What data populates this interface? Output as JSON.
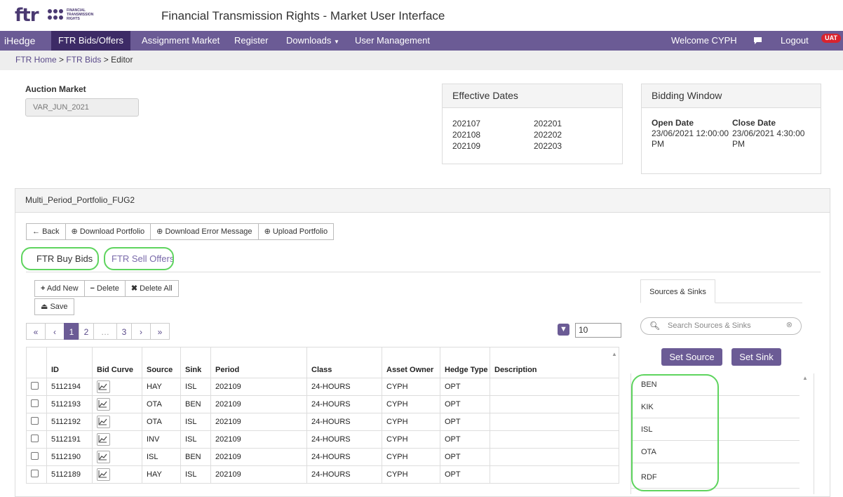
{
  "header": {
    "logo_text": "ftr",
    "logo_sub": [
      "FINANCIAL",
      "TRANSMISSION",
      "RIGHTS"
    ],
    "title": "Financial Transmission Rights - Market User Interface"
  },
  "nav": {
    "brand": "iHedge",
    "items": [
      "FTR Bids/Offers",
      "Assignment Market",
      "Register",
      "Downloads",
      "User Management"
    ],
    "welcome": "Welcome CYPH",
    "logout": "Logout",
    "env_badge": "UAT"
  },
  "breadcrumb": {
    "home": "FTR Home",
    "sep": ">",
    "bids": "FTR Bids",
    "current": "Editor"
  },
  "auction": {
    "label": "Auction Market",
    "value": "VAR_JUN_2021"
  },
  "effective_dates": {
    "title": "Effective Dates",
    "col1": [
      "202107",
      "202108",
      "202109"
    ],
    "col2": [
      "202201",
      "202202",
      "202203"
    ]
  },
  "bidding_window": {
    "title": "Bidding Window",
    "open_label": "Open Date",
    "close_label": "Close Date",
    "open_value": "23/06/2021 12:00:00 PM",
    "close_value": "23/06/2021 4:30:00 PM"
  },
  "portfolio": {
    "title": "Multi_Period_Portfolio_FUG2",
    "toolbar": {
      "back": "Back",
      "download_portfolio": "Download Portfolio",
      "download_error": "Download Error Message",
      "upload_portfolio": "Upload Portfolio"
    },
    "tabs": [
      "FTR Buy Bids",
      "FTR Sell Offers"
    ],
    "actions": {
      "add_new": "Add New",
      "delete": "Delete",
      "delete_all": "Delete All",
      "save": "Save"
    },
    "pagination": [
      "«",
      "‹",
      "1",
      "2",
      "…",
      "3",
      "›",
      "»"
    ],
    "page_size": "10",
    "columns": [
      "ID",
      "Bid Curve",
      "Source",
      "Sink",
      "Period",
      "Class",
      "Asset Owner",
      "Hedge Type",
      "Description"
    ],
    "rows": [
      {
        "id": "5112194",
        "source": "HAY",
        "sink": "ISL",
        "period": "202109",
        "class": "24-HOURS",
        "owner": "CYPH",
        "hedge": "OPT",
        "desc": ""
      },
      {
        "id": "5112193",
        "source": "OTA",
        "sink": "BEN",
        "period": "202109",
        "class": "24-HOURS",
        "owner": "CYPH",
        "hedge": "OPT",
        "desc": ""
      },
      {
        "id": "5112192",
        "source": "OTA",
        "sink": "ISL",
        "period": "202109",
        "class": "24-HOURS",
        "owner": "CYPH",
        "hedge": "OPT",
        "desc": ""
      },
      {
        "id": "5112191",
        "source": "INV",
        "sink": "ISL",
        "period": "202109",
        "class": "24-HOURS",
        "owner": "CYPH",
        "hedge": "OPT",
        "desc": ""
      },
      {
        "id": "5112190",
        "source": "ISL",
        "sink": "BEN",
        "period": "202109",
        "class": "24-HOURS",
        "owner": "CYPH",
        "hedge": "OPT",
        "desc": ""
      },
      {
        "id": "5112189",
        "source": "HAY",
        "sink": "ISL",
        "period": "202109",
        "class": "24-HOURS",
        "owner": "CYPH",
        "hedge": "OPT",
        "desc": ""
      }
    ]
  },
  "sources_sinks": {
    "tab": "Sources & Sinks",
    "search_placeholder": "Search Sources & Sinks",
    "set_source": "Set Source",
    "set_sink": "Set Sink",
    "items": [
      "BEN",
      "KIK",
      "ISL",
      "OTA",
      "RDF"
    ]
  },
  "colors": {
    "brand_purple": "#6b5b95",
    "nav_active": "#3d2b66",
    "highlight_ring": "#5ed45e",
    "uat_badge": "#d9232e"
  }
}
